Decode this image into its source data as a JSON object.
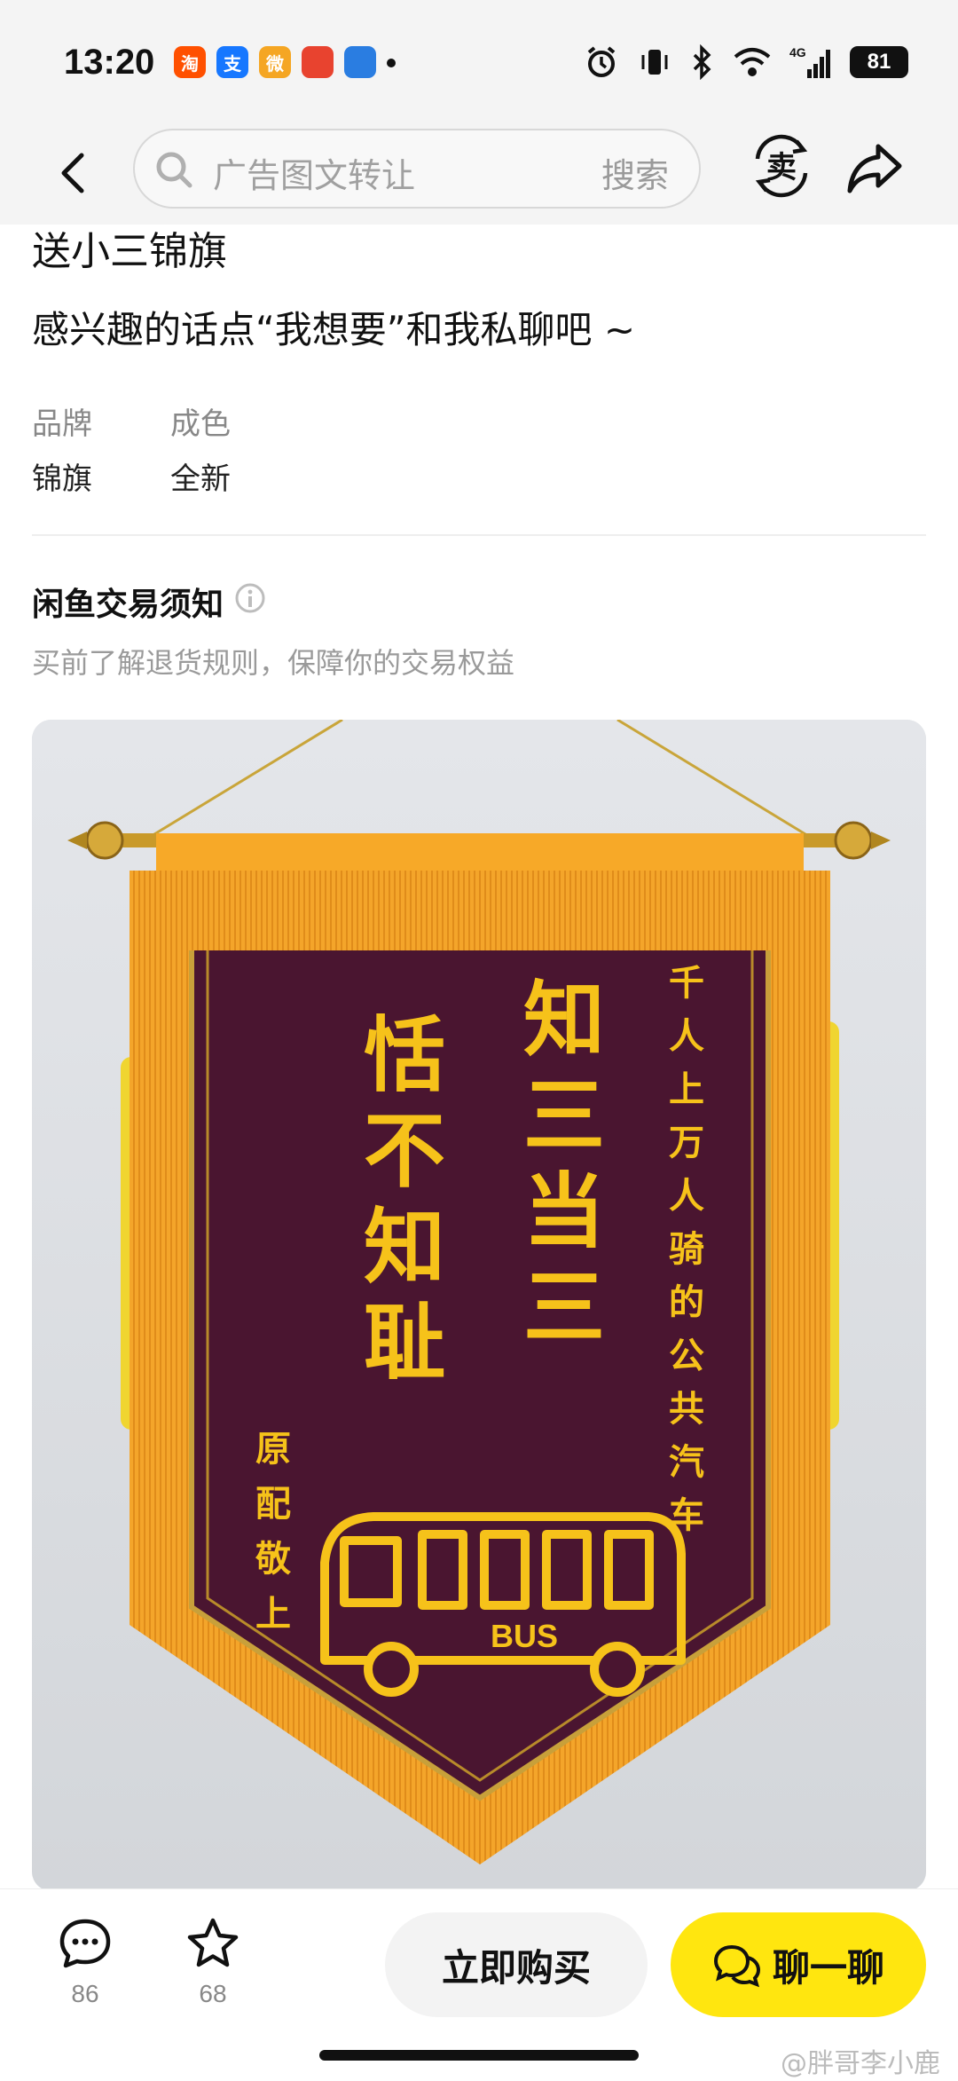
{
  "status_bar": {
    "time": "13:20",
    "apps": [
      {
        "icon": "taobao-icon",
        "glyph": "淘",
        "color": "#ff5000"
      },
      {
        "icon": "alipay-icon",
        "glyph": "支",
        "color": "#1677ff"
      },
      {
        "icon": "weibo-icon",
        "glyph": "微",
        "color": "#f5a623"
      },
      {
        "icon": "app-icon",
        "glyph": "",
        "color": "#e8432f"
      },
      {
        "icon": "app-icon-2",
        "glyph": "",
        "color": "#2a7de1"
      }
    ],
    "network": "4G",
    "battery": "81"
  },
  "nav": {
    "search_placeholder": "广告图文转让",
    "search_button": "搜索",
    "sell_label": "卖"
  },
  "product": {
    "title": "送小三锦旗",
    "description": "感兴趣的话点“我想要”和我私聊吧 ~",
    "attributes": [
      {
        "label": "品牌",
        "value": "锦旗"
      },
      {
        "label": "成色",
        "value": "全新"
      }
    ]
  },
  "notice": {
    "title": "闲鱼交易须知",
    "subtitle": "买前了解退货规则，保障你的交易权益"
  },
  "banner": {
    "right_column": "千人上万人骑的公共汽车",
    "center_column": "知三当三",
    "left_column": "恬不知耻",
    "signature": "原配敬上",
    "bus_text": "BUS"
  },
  "bottom_bar": {
    "comment_count": "86",
    "favorite_count": "68",
    "buy_label": "立即购买",
    "chat_label": "聊一聊"
  },
  "watermark": "@胖哥李小鹿",
  "colors": {
    "accent_yellow": "#ffe60f",
    "banner_purple": "#4a1530",
    "banner_gold": "#f6c21a",
    "fringe": "#f4a52a"
  }
}
